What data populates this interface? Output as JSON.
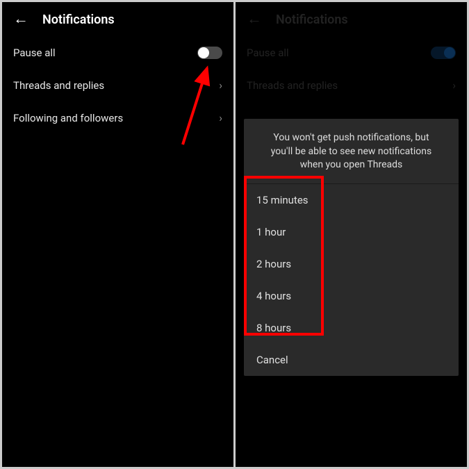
{
  "left": {
    "title": "Notifications",
    "pause_all": "Pause all",
    "threads": "Threads and replies",
    "following": "Following and followers"
  },
  "right": {
    "title": "Notifications",
    "pause_all": "Pause all",
    "threads": "Threads and replies",
    "sheet": {
      "message": "You won't get push notifications, but you'll be able to see new notifications when you open Threads",
      "opt1": "15 minutes",
      "opt2": "1 hour",
      "opt3": "2 hours",
      "opt4": "4 hours",
      "opt5": "8 hours",
      "cancel": "Cancel"
    }
  }
}
